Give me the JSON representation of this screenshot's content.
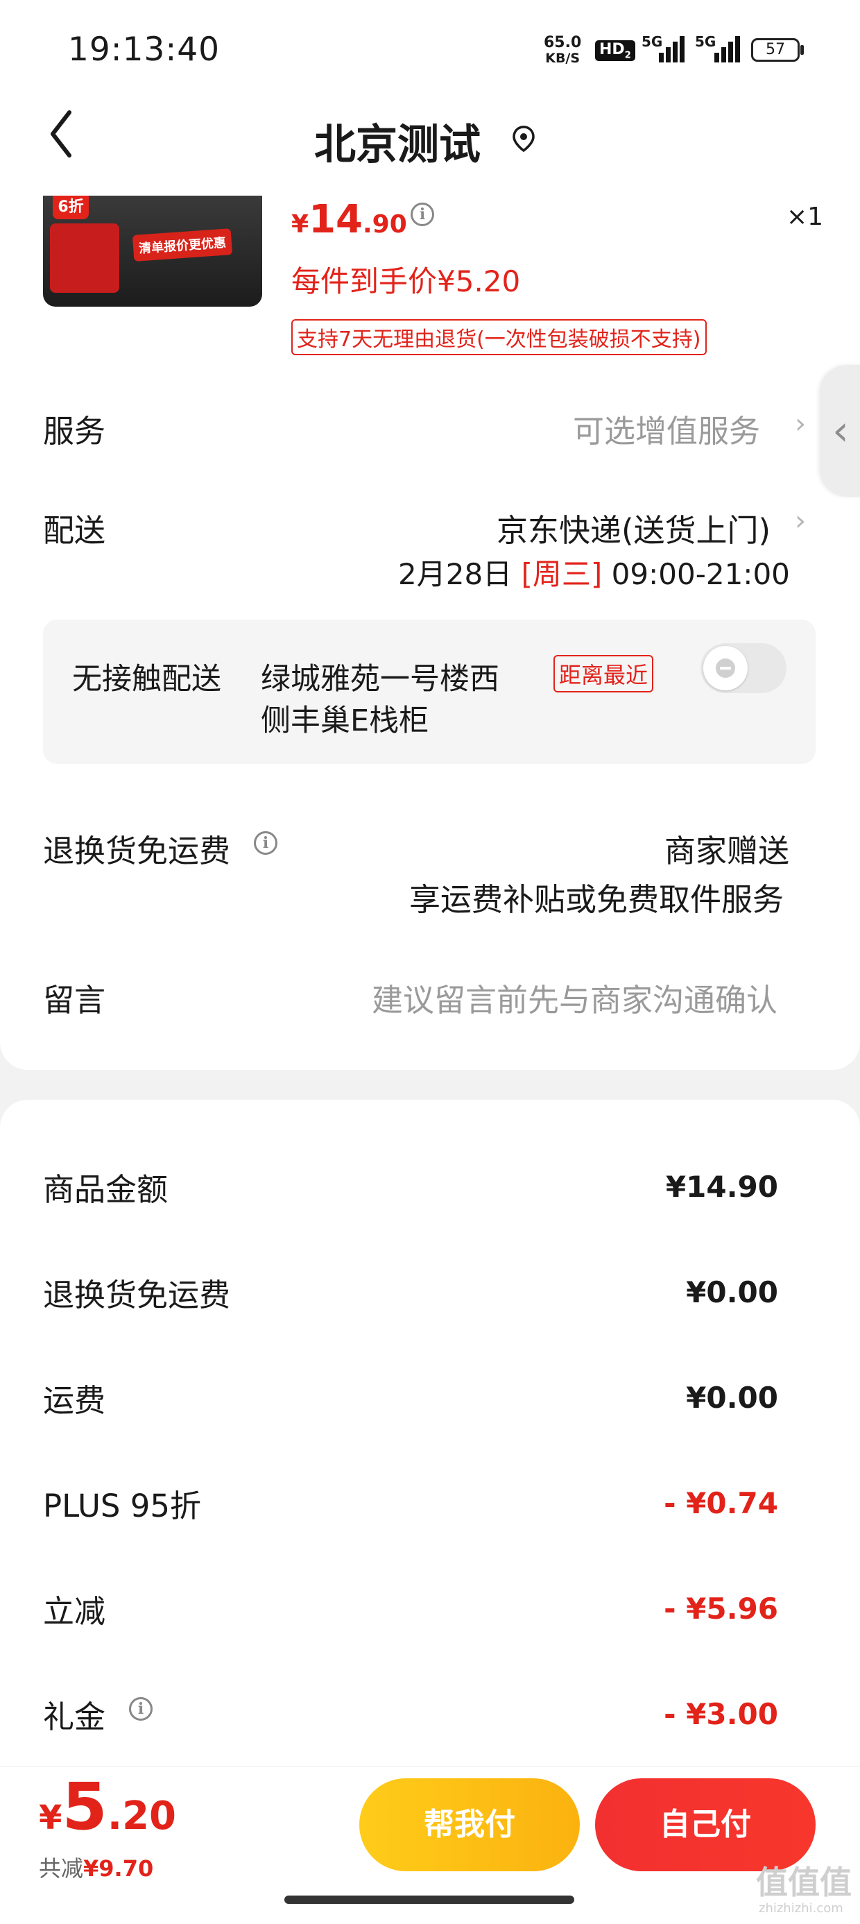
{
  "status_bar": {
    "time": "19:13:40",
    "net_speed_value": "65.0",
    "net_speed_unit": "KB/S",
    "hd_badge": "HD",
    "hd_sub": "2",
    "sim1": "5G",
    "sim2": "5G",
    "battery": "57"
  },
  "header": {
    "title": "北京测试"
  },
  "product": {
    "thumbnail_badge": "6折",
    "thumbnail_caption": "清单报价更优惠",
    "price_currency": "¥",
    "price_int": "14",
    "price_dec": ".90",
    "quantity": "×1",
    "unit_price": "每件到手价¥5.20",
    "return_policy": "支持7天无理由退货(一次性包装破损不支持)"
  },
  "service": {
    "label": "服务",
    "value": "可选增值服务"
  },
  "delivery": {
    "label": "配送",
    "method": "京东快递(送货上门)",
    "date": "2月28日",
    "weekday": "[周三]",
    "time_range": "09:00-21:00"
  },
  "no_contact": {
    "label": "无接触配送",
    "address_line1": "绿城雅苑一号楼西",
    "address_line2": "侧丰巢E栈柜",
    "tag": "距离最近"
  },
  "return_shipping": {
    "label": "退换货免运费",
    "value": "商家赠送",
    "sub": "享运费补贴或免费取件服务"
  },
  "message": {
    "label": "留言",
    "placeholder": "建议留言前先与商家沟通确认"
  },
  "summary": [
    {
      "label": "商品金额",
      "value": "¥14.90",
      "discount": false,
      "info": false
    },
    {
      "label": "退换货免运费",
      "value": "¥0.00",
      "discount": false,
      "info": false
    },
    {
      "label": "运费",
      "value": "¥0.00",
      "discount": false,
      "info": false
    },
    {
      "label": "PLUS 95折",
      "value": "- ¥0.74",
      "discount": true,
      "info": false
    },
    {
      "label": "立减",
      "value": "- ¥5.96",
      "discount": true,
      "info": false
    },
    {
      "label": "礼金",
      "value": "- ¥3.00",
      "discount": true,
      "info": true
    }
  ],
  "bottom": {
    "total_currency": "¥",
    "total_int": "5",
    "total_dec": ".20",
    "saved_label": "共减",
    "saved_value": "¥9.70",
    "help_pay": "帮我付",
    "self_pay": "自己付"
  },
  "watermark": {
    "main": "值值值",
    "sub": "zhizhizhi.com"
  },
  "colors": {
    "accent_red": "#e2231a",
    "help_yellow": "#fbb20f",
    "pay_red": "#f23030"
  }
}
